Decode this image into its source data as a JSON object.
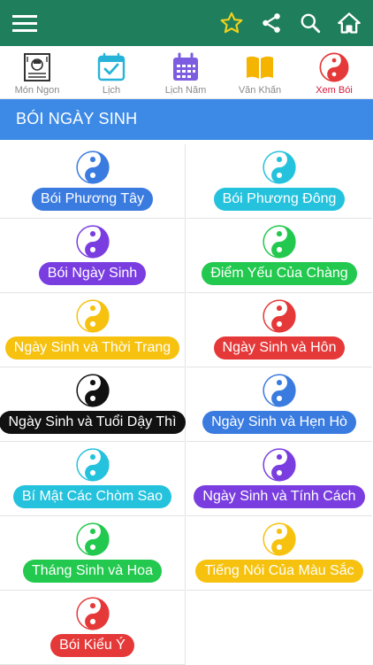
{
  "tabs": [
    {
      "label": "Món Ngon",
      "icon": "cookbook-icon"
    },
    {
      "label": "Lịch",
      "icon": "calendar-check-icon"
    },
    {
      "label": "Lịch Năm",
      "icon": "calendar-grid-icon"
    },
    {
      "label": "Văn Khấn",
      "icon": "book-icon"
    },
    {
      "label": "Xem Bói",
      "icon": "yin-yang-icon",
      "active": true
    }
  ],
  "section": {
    "title": "BÓI NGÀY SINH"
  },
  "items": [
    {
      "label": "Bói Phương Tây",
      "color": "#3a7be0"
    },
    {
      "label": "Bói Phương Đông",
      "color": "#24c2dd"
    },
    {
      "label": "Bói Ngày Sinh",
      "color": "#7a3ee0"
    },
    {
      "label": "Điểm Yếu Của Chàng",
      "color": "#22c94e"
    },
    {
      "label": "Ngày Sinh và Thời Trang",
      "color": "#f6c20f"
    },
    {
      "label": "Ngày Sinh và Hôn",
      "color": "#e53939"
    },
    {
      "label": "Ngày Sinh và Tuổi Dậy Thì",
      "color": "#111111"
    },
    {
      "label": "Ngày Sinh và Hẹn Hò",
      "color": "#3a7be0"
    },
    {
      "label": "Bí Mật Các Chòm Sao",
      "color": "#24c2dd"
    },
    {
      "label": "Ngày Sinh và Tính Cách",
      "color": "#7a3ee0"
    },
    {
      "label": "Tháng Sinh và Hoa",
      "color": "#22c94e"
    },
    {
      "label": "Tiếng Nói Của Màu Sắc",
      "color": "#f6c20f"
    },
    {
      "label": "Bói Kiểu Ý",
      "color": "#e53939"
    }
  ],
  "colors": {
    "topbar": "#1f7f5c",
    "section": "#3d8ae6",
    "active_tab": "#d81b3b",
    "star": "#f2d21b"
  }
}
